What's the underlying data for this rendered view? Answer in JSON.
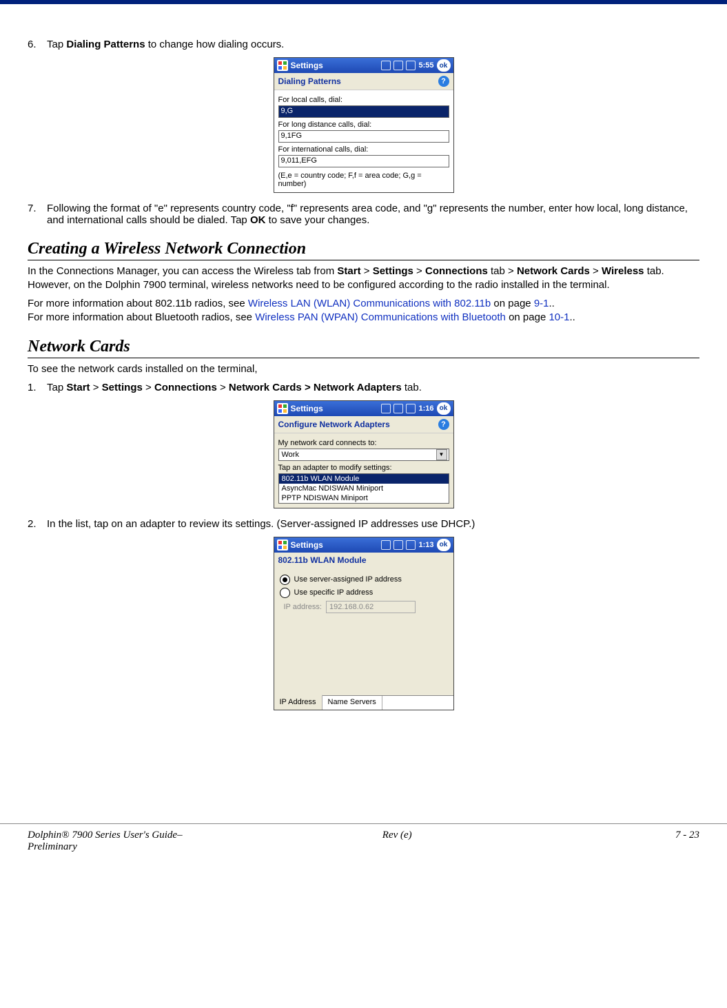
{
  "step6": {
    "num": "6.",
    "pre": "Tap ",
    "bold": "Dialing Patterns",
    "post": " to change how dialing occurs."
  },
  "shot1": {
    "title": "Settings",
    "time": "5:55",
    "ok": "ok",
    "subtitle": "Dialing Patterns",
    "label_local": "For local calls, dial:",
    "value_local": "9,G",
    "label_long": "For long distance calls, dial:",
    "value_long": "9,1FG",
    "label_intl": "For international calls, dial:",
    "value_intl": "9,011,EFG",
    "hint": "(E,e = country code; F,f = area code; G,g = number)"
  },
  "step7": {
    "num": "7.",
    "txt_pre": "Following the format of \"e\" represents country code, \"f\" represents area code, and \"g\" represents the number, enter how local, long distance, and international calls should be dialed. Tap ",
    "txt_bold": "OK",
    "txt_post": " to save your changes."
  },
  "heading1": "Creating a Wireless Network Connection",
  "para1": {
    "p1a": "In the Connections Manager, you can access the Wireless tab from ",
    "start": "Start",
    "gt": " > ",
    "settings": "Settings",
    "connections": "Connections",
    "tab_word": " tab > ",
    "netcards": "Network Cards",
    "gt2": " > ",
    "wireless": "Wireless",
    "p1b": " tab. However, on the Dolphin 7900 terminal, wireless networks need to be configured according to the radio installed in the terminal."
  },
  "para2": {
    "l1a": "For more information about 802.11b radios, see ",
    "l1link": "Wireless LAN (WLAN) Communications with 802.11b",
    "l1mid": " on page ",
    "l1page": "9-1",
    "l1end": "..",
    "l2a": "For more information about Bluetooth radios, see ",
    "l2link": "Wireless PAN (WPAN) Communications with Bluetooth",
    "l2mid": " on page ",
    "l2page": "10-1",
    "l2end": ".."
  },
  "heading2": "Network Cards",
  "para3": "To see the network cards installed on the terminal,",
  "nc_step1": {
    "num": "1.",
    "pre": "Tap ",
    "start": "Start",
    "settings": "Settings",
    "connections": "Connections",
    "netcards": "Network Cards > Network Adapters",
    "post": " tab."
  },
  "shot2": {
    "title": "Settings",
    "time": "1:16",
    "ok": "ok",
    "subtitle": "Configure Network Adapters",
    "label1": "My network card connects to:",
    "dropdown_value": "Work",
    "label2": "Tap an adapter to modify settings:",
    "row1": "802.11b WLAN Module",
    "row2": "AsyncMac NDISWAN Miniport",
    "row3": "PPTP NDISWAN Miniport"
  },
  "nc_step2": {
    "num": "2.",
    "txt": "In the list, tap on an adapter to review its settings. (Server-assigned IP addresses use DHCP.)"
  },
  "shot3": {
    "title": "Settings",
    "time": "1:13",
    "ok": "ok",
    "subtitle": "802.11b WLAN Module",
    "radio1": "Use server-assigned IP address",
    "radio2": "Use specific IP address",
    "ip_label": "IP address:",
    "ip_value": "192.168.0.62",
    "tab1": "IP Address",
    "tab2": "Name Servers"
  },
  "footer": {
    "left1": "Dolphin® 7900 Series User's Guide–",
    "left2": "Preliminary",
    "center": "Rev (e)",
    "right": "7 - 23"
  }
}
